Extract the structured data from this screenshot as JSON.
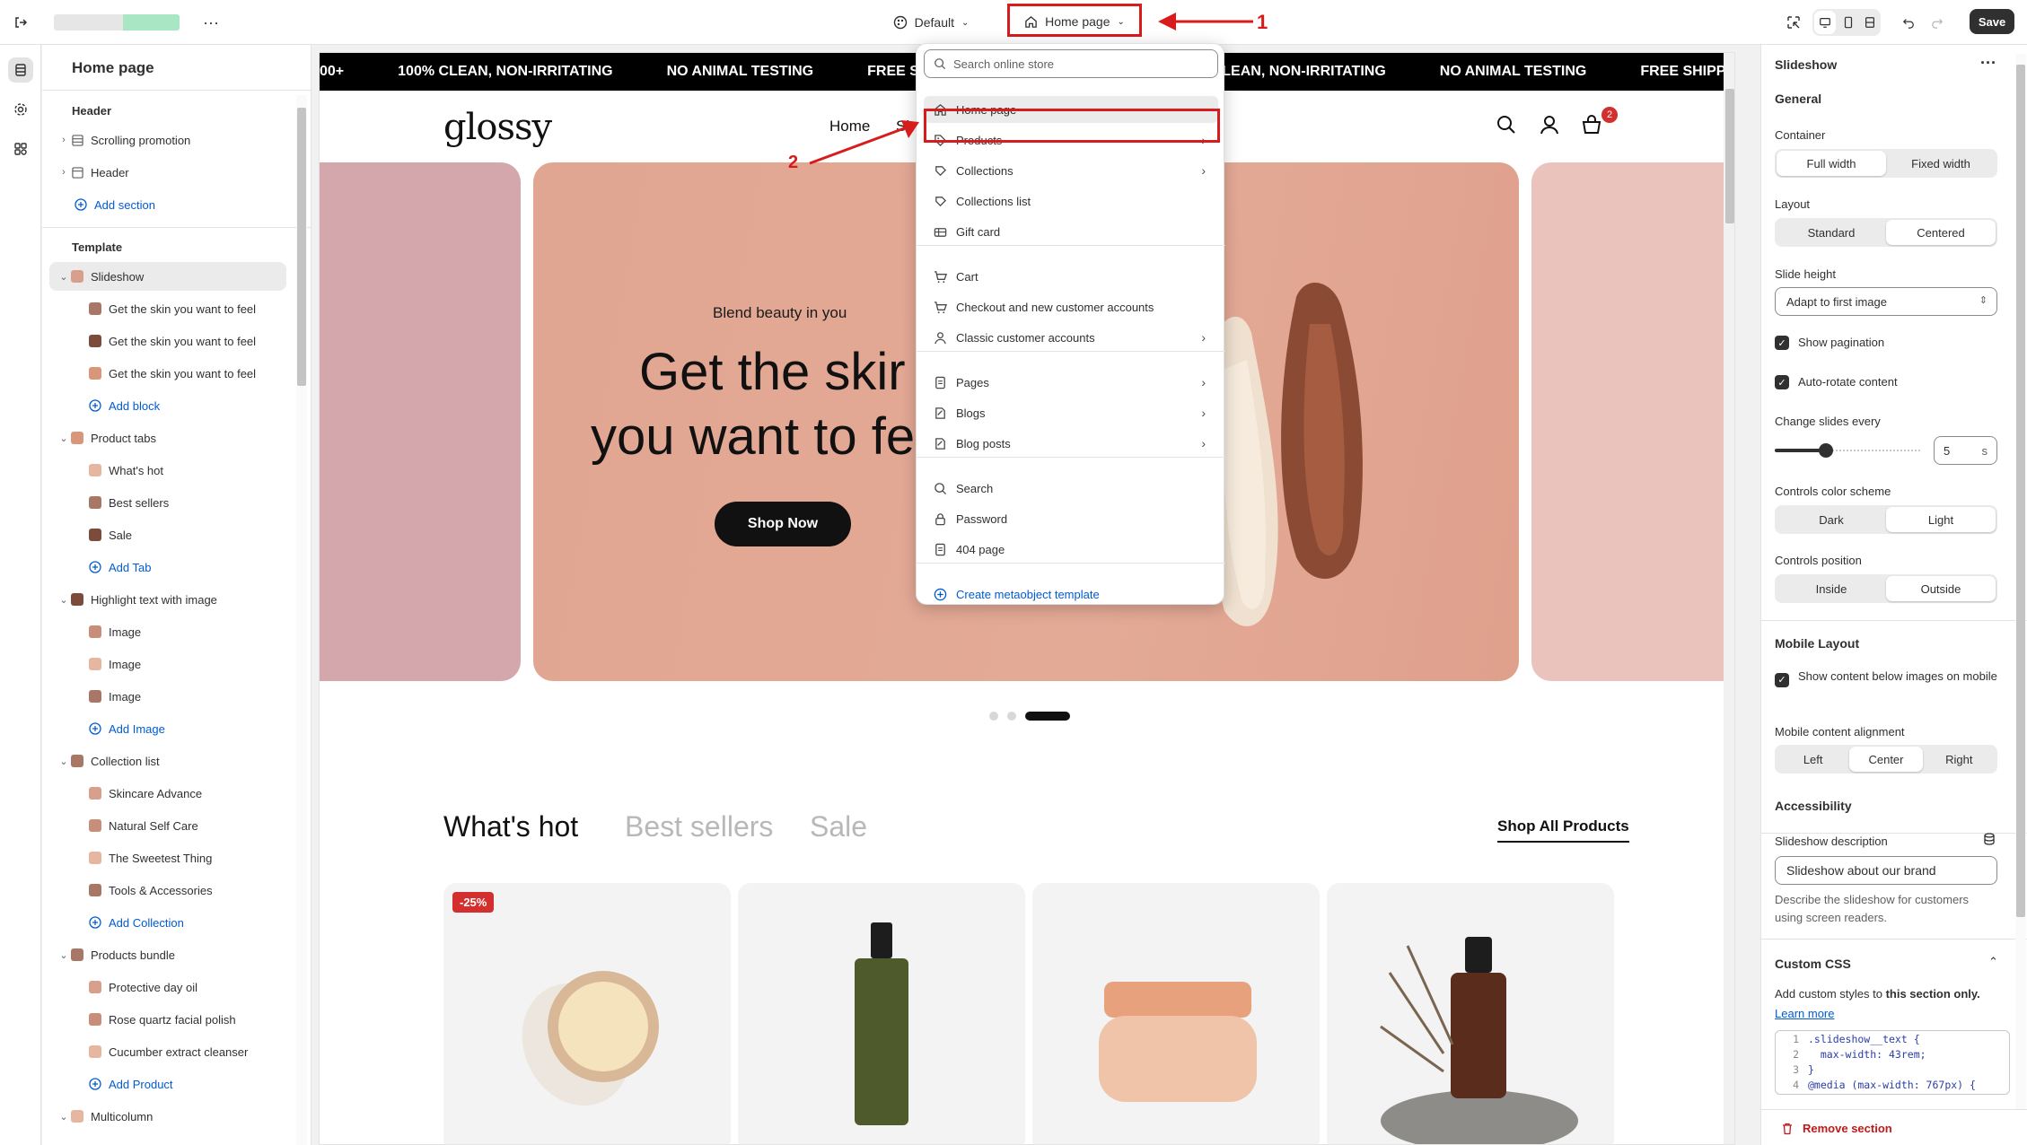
{
  "topbar": {
    "theme_label": "Default",
    "page_selector_label": "Home page",
    "save_label": "Save",
    "more_label": "···"
  },
  "annotations": {
    "step1": "1",
    "step2": "2"
  },
  "left_panel": {
    "title": "Home page",
    "header_group": "Header",
    "header_items": [
      "Scrolling promotion",
      "Header"
    ],
    "add_section": "Add section",
    "template_group": "Template",
    "tree": [
      {
        "label": "Slideshow",
        "type": "section",
        "selected": true
      },
      {
        "label": "Get the skin you want to feel",
        "type": "block"
      },
      {
        "label": "Get the skin you want to feel",
        "type": "block"
      },
      {
        "label": "Get the skin you want to feel",
        "type": "block"
      },
      {
        "label": "Add block",
        "type": "add"
      },
      {
        "label": "Product tabs",
        "type": "section"
      },
      {
        "label": "What's hot",
        "type": "block"
      },
      {
        "label": "Best sellers",
        "type": "block"
      },
      {
        "label": "Sale",
        "type": "block"
      },
      {
        "label": "Add Tab",
        "type": "add"
      },
      {
        "label": "Highlight text with image",
        "type": "section"
      },
      {
        "label": "Image",
        "type": "block"
      },
      {
        "label": "Image",
        "type": "block"
      },
      {
        "label": "Image",
        "type": "block"
      },
      {
        "label": "Add Image",
        "type": "add"
      },
      {
        "label": "Collection list",
        "type": "section"
      },
      {
        "label": "Skincare Advance",
        "type": "block"
      },
      {
        "label": "Natural Self Care",
        "type": "block"
      },
      {
        "label": "The Sweetest Thing",
        "type": "block"
      },
      {
        "label": "Tools & Accessories",
        "type": "block"
      },
      {
        "label": "Add Collection",
        "type": "add"
      },
      {
        "label": "Products bundle",
        "type": "section"
      },
      {
        "label": "Protective day oil",
        "type": "block"
      },
      {
        "label": "Rose quartz facial polish",
        "type": "block"
      },
      {
        "label": "Cucumber extract cleanser",
        "type": "block"
      },
      {
        "label": "Add Product",
        "type": "add"
      },
      {
        "label": "Multicolumn",
        "type": "section"
      }
    ]
  },
  "preview": {
    "marquee": [
      "00+",
      "100% CLEAN, NON-IRRITATING",
      "NO ANIMAL TESTING",
      "FREE SHIPP",
      "LEAN, NON-IRRITATING",
      "NO ANIMAL TESTING",
      "FREE SHIPPING ON"
    ],
    "logo": "glossy",
    "nav": [
      "Home",
      "Sh"
    ],
    "cart_count": "2",
    "slide_eyebrow": "Blend beauty in you",
    "slide_heading_1": "Get the skir",
    "slide_heading_2": "you want to fe",
    "slide_button": "Shop Now",
    "tabs": [
      "What's hot",
      "Best sellers",
      "Sale"
    ],
    "shop_all": "Shop All Products",
    "badge": "-25%"
  },
  "dropdown": {
    "search_placeholder": "Search online store",
    "items": [
      {
        "label": "Home page",
        "icon": "home-icon",
        "submenu": false
      },
      {
        "label": "Products",
        "icon": "tag-icon",
        "submenu": true
      },
      {
        "label": "Collections",
        "icon": "collection-icon",
        "submenu": true
      },
      {
        "label": "Collections list",
        "icon": "collection-icon",
        "submenu": false
      },
      {
        "label": "Gift card",
        "icon": "gift-card-icon",
        "submenu": false
      },
      {
        "label": "Cart",
        "icon": "cart-icon",
        "submenu": false
      },
      {
        "label": "Checkout and new customer accounts",
        "icon": "cart-icon",
        "submenu": false
      },
      {
        "label": "Classic customer accounts",
        "icon": "person-icon",
        "submenu": true
      },
      {
        "label": "Pages",
        "icon": "page-icon",
        "submenu": true
      },
      {
        "label": "Blogs",
        "icon": "blog-icon",
        "submenu": true
      },
      {
        "label": "Blog posts",
        "icon": "blog-icon",
        "submenu": true
      },
      {
        "label": "Search",
        "icon": "search-icon",
        "submenu": false
      },
      {
        "label": "Password",
        "icon": "lock-icon",
        "submenu": false
      },
      {
        "label": "404 page",
        "icon": "page-icon",
        "submenu": false
      },
      {
        "label": "Create metaobject template",
        "icon": "plus-circle-icon",
        "submenu": false
      }
    ]
  },
  "right_panel": {
    "title": "Slideshow",
    "general": "General",
    "container_label": "Container",
    "container_options": [
      "Full width",
      "Fixed width"
    ],
    "layout_label": "Layout",
    "layout_options": [
      "Standard",
      "Centered"
    ],
    "slide_height_label": "Slide height",
    "slide_height_value": "Adapt to first image",
    "show_pagination": "Show pagination",
    "auto_rotate": "Auto-rotate content",
    "change_slides_label": "Change slides every",
    "change_slides_value": "5",
    "change_slides_unit": "s",
    "change_slides_fraction": 0.35,
    "controls_color_label": "Controls color scheme",
    "controls_color_options": [
      "Dark",
      "Light"
    ],
    "controls_position_label": "Controls position",
    "controls_position_options": [
      "Inside",
      "Outside"
    ],
    "mobile_layout": "Mobile Layout",
    "mobile_show_content": "Show content below images on mobile",
    "mobile_alignment_label": "Mobile content alignment",
    "mobile_alignment_options": [
      "Left",
      "Center",
      "Right"
    ],
    "accessibility": "Accessibility",
    "slideshow_description_label": "Slideshow description",
    "slideshow_description_value": "Slideshow about our brand",
    "slideshow_description_help": "Describe the slideshow for customers using screen readers.",
    "custom_css": "Custom CSS",
    "custom_css_help_1": "Add custom styles to",
    "custom_css_help_2": "this section only.",
    "learn_more": "Learn more",
    "code_lines": [
      {
        "n": "1",
        "text": ".slideshow__text {"
      },
      {
        "n": "2",
        "text": "  max-width: 43rem;"
      },
      {
        "n": "3",
        "text": "}"
      },
      {
        "n": "4",
        "text": "@media (max-width: 767px) {"
      }
    ],
    "remove_section": "Remove section"
  }
}
